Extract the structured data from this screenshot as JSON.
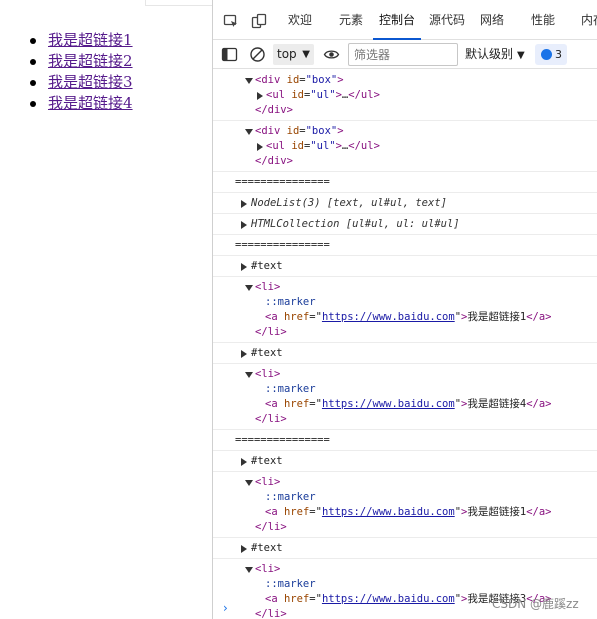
{
  "page": {
    "links": [
      "我是超链接1",
      "我是超链接2",
      "我是超链接3",
      "我是超链接4"
    ]
  },
  "devtools": {
    "tabs": [
      "欢迎",
      "元素",
      "控制台",
      "源代码",
      "网络",
      "性能",
      "内存"
    ],
    "active_tab": "控制台",
    "toolbar": {
      "context": "top",
      "filter_placeholder": "筛选器",
      "levels": "默认级别",
      "issues_count": "3"
    }
  },
  "console": {
    "div_open": "div",
    "div_id_attr": "id",
    "div_id_val": "\"box\"",
    "ul_open": "ul",
    "ul_id_val": "\"ul\"",
    "ellipsis": "…",
    "separator": "===============",
    "nodelist": "NodeList(3) [text, ul#ul, text]",
    "htmlcollection": "HTMLCollection [ul#ul, ul: ul#ul]",
    "text_node": "#text",
    "li": "li",
    "marker": "::marker",
    "href_attr": "href",
    "href_url": "https://www.baidu.com",
    "link_texts": [
      "我是超链接1",
      "我是超链接4",
      "我是超链接1",
      "我是超链接3"
    ]
  },
  "watermark": "CSDN @鹿蹊zz"
}
